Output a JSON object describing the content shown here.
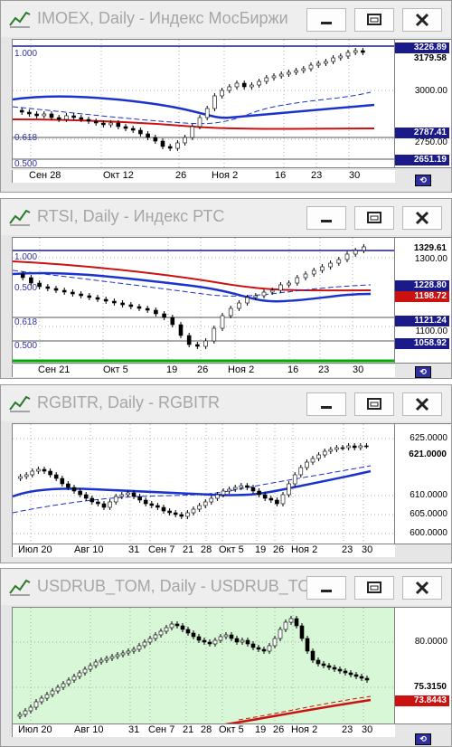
{
  "windows": [
    {
      "id": "imoex",
      "title": "IMOEX, Daily - Индекс МосБиржи",
      "plot_bg": "#ffffff",
      "fib_labels": [
        "1.000",
        "0.618",
        "0.500"
      ],
      "price_labels": [
        "3000.00",
        "2750.00"
      ],
      "badges": [
        {
          "text": "3226.89",
          "bg": "#1a1a8a",
          "fg": "#ffffff"
        },
        {
          "text": "3179.58",
          "bg": "#ffffff",
          "fg": "#000000"
        },
        {
          "text": "2787.41",
          "bg": "#1a1a8a",
          "fg": "#ffffff"
        },
        {
          "text": "2651.19",
          "bg": "#1a1a8a",
          "fg": "#ffffff"
        }
      ],
      "x_labels": [
        "Сен 28",
        "Окт 12",
        "26",
        "Ноя 2",
        "16",
        "23",
        "30"
      ]
    },
    {
      "id": "rtsi",
      "title": "RTSI, Daily - Индекс РТС",
      "plot_bg": "#ffffff",
      "fib_labels": [
        "1.000",
        "0.500",
        "0.618",
        "0.500"
      ],
      "price_labels": [
        "1300.00",
        "1100.00"
      ],
      "badges": [
        {
          "text": "1329.61",
          "bg": "#ffffff",
          "fg": "#000000"
        },
        {
          "text": "1228.80",
          "bg": "#1a1a8a",
          "fg": "#ffffff"
        },
        {
          "text": "1198.72",
          "bg": "#cc1111",
          "fg": "#ffffff"
        },
        {
          "text": "1121.24",
          "bg": "#1a1a8a",
          "fg": "#ffffff"
        },
        {
          "text": "1058.92",
          "bg": "#1a1a8a",
          "fg": "#ffffff"
        }
      ],
      "x_labels": [
        "Сен 21",
        "Окт 5",
        "19",
        "26",
        "Ноя 2",
        "16",
        "23",
        "30"
      ]
    },
    {
      "id": "rgbitr",
      "title": "RGBITR, Daily - RGBITR",
      "plot_bg": "#ffffff",
      "price_labels": [
        "625.0000",
        "610.0000",
        "605.0000",
        "600.0000"
      ],
      "badges": [
        {
          "text": "621.0000",
          "bg": "#ffffff",
          "fg": "#000000"
        }
      ],
      "x_labels": [
        "Июл 20",
        "Авг 10",
        "31",
        "Сен 7",
        "21",
        "28",
        "Окт 5",
        "19",
        "26",
        "Ноя 2",
        "23",
        "30"
      ]
    },
    {
      "id": "usdrub",
      "title": "USDRUB_TOM, Daily - USDRUB_TOM",
      "plot_bg": "#d7f7d7",
      "price_labels": [
        "80.0000"
      ],
      "badges": [
        {
          "text": "75.3150",
          "bg": "#ffffff",
          "fg": "#000000"
        },
        {
          "text": "73.8443",
          "bg": "#cc1111",
          "fg": "#ffffff"
        }
      ],
      "x_labels": [
        "Июл 20",
        "Авг 10",
        "31",
        "Сен 7",
        "21",
        "28",
        "Окт 5",
        "19",
        "26",
        "Ноя 2",
        "23",
        "30"
      ]
    }
  ],
  "icons": {
    "minimize": "minimize-icon",
    "maximize": "maximize-icon",
    "close": "close-icon",
    "chart": "chart-app-icon",
    "sync": "sync-icon"
  }
}
